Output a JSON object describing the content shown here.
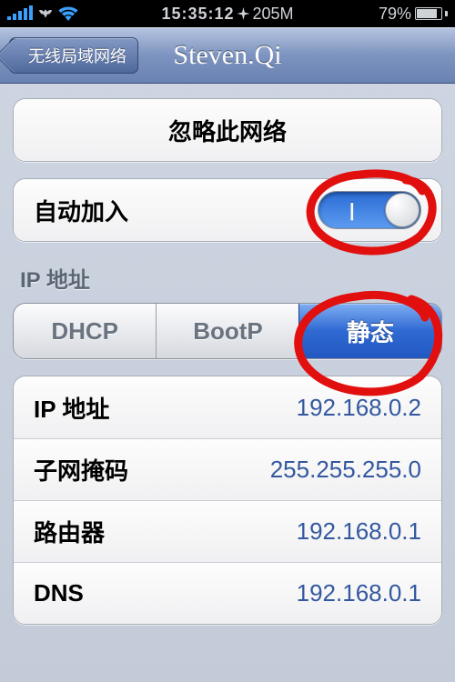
{
  "status": {
    "time": "15:35:12",
    "extra": "205M",
    "battery_pct": "79%"
  },
  "nav": {
    "back_label": "无线局域网络",
    "title": "Steven.Qi"
  },
  "forget_button": "忽略此网络",
  "auto_join": {
    "label": "自动加入",
    "on_mark": "|",
    "on": true
  },
  "ip_section_header": "IP 地址",
  "segments": {
    "dhcp": "DHCP",
    "bootp": "BootP",
    "static": "静态",
    "selected": "static"
  },
  "rows": [
    {
      "label": "IP 地址",
      "value": "192.168.0.2"
    },
    {
      "label": "子网掩码",
      "value": "255.255.255.0"
    },
    {
      "label": "路由器",
      "value": "192.168.0.1"
    },
    {
      "label": "DNS",
      "value": "192.168.0.1"
    }
  ]
}
